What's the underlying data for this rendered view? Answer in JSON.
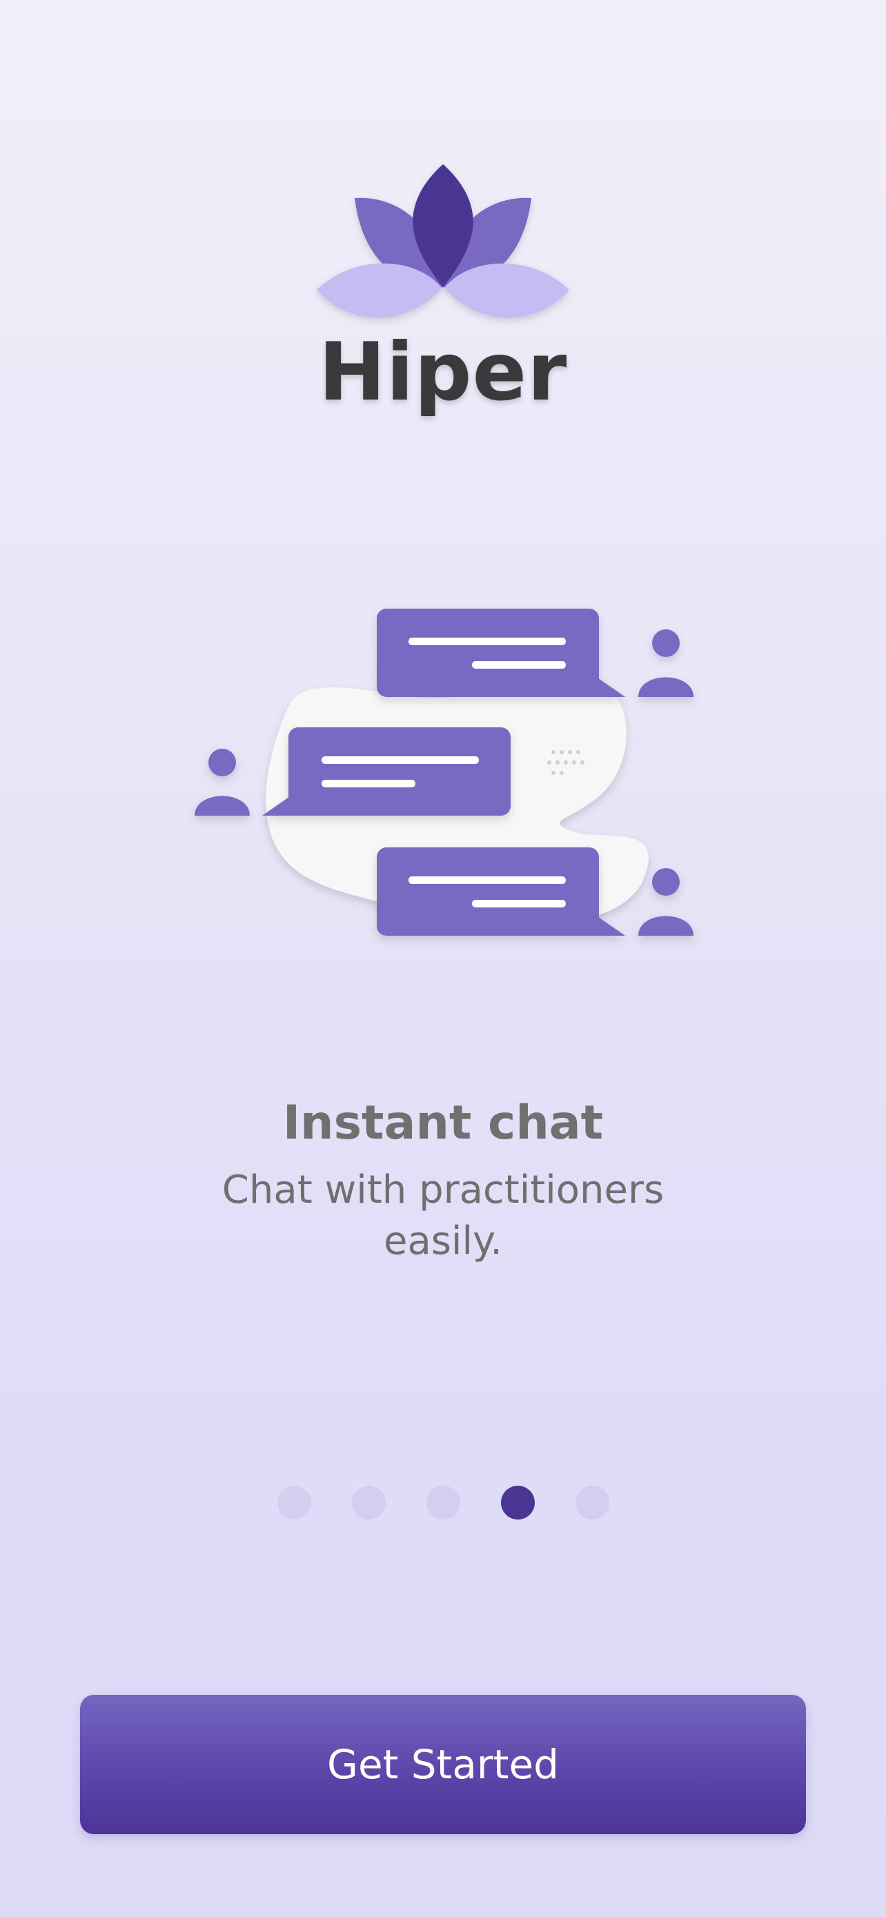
{
  "brand": {
    "name": "Hiper",
    "colors": {
      "petal_dark": "#4a3592",
      "petal_mid": "#7a69c3",
      "petal_light": "#c6bbf2",
      "wordmark": "#3a3a3c"
    }
  },
  "illustration": {
    "description_icon": "chat-illustration",
    "accent": "#7a69c3"
  },
  "onboarding": {
    "title": "Instant chat",
    "description": "Chat with practitioners easily.",
    "pagination": {
      "total": 5,
      "active_index": 3
    }
  },
  "actions": {
    "get_started_label": "Get Started"
  }
}
